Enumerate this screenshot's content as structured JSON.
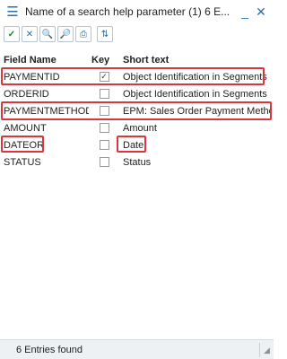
{
  "window": {
    "title": "Name of a search help parameter (1)   6 E...",
    "menu_icon": "hamburger-icon",
    "minimize_glyph": "_",
    "close_glyph": "✕"
  },
  "toolbar": {
    "buttons": [
      {
        "name": "ok-button",
        "icon": "checkmark-icon",
        "glyph": "✓"
      },
      {
        "name": "cancel-button",
        "icon": "close-box-icon",
        "glyph": "✕"
      },
      {
        "name": "find-button",
        "icon": "magnifier-icon",
        "glyph": "🔍"
      },
      {
        "name": "find-next-button",
        "icon": "magnifier-plus-icon",
        "glyph": "🔎"
      },
      {
        "name": "print-button",
        "icon": "printer-icon",
        "glyph": "⎙"
      },
      {
        "name": "sort-button",
        "icon": "sort-icon",
        "glyph": "⇅"
      }
    ]
  },
  "table": {
    "headers": [
      "Field Name",
      "Key",
      "Short text"
    ],
    "rows": [
      {
        "field": "PAYMENTID",
        "key": true,
        "text": "Object Identification in Segments",
        "highlight": true
      },
      {
        "field": "ORDERID",
        "key": false,
        "text": "Object Identification in Segments",
        "highlight": false
      },
      {
        "field": "PAYMENTMETHOD",
        "key": false,
        "text": "EPM: Sales Order Payment Method",
        "highlight": true
      },
      {
        "field": "AMOUNT",
        "key": false,
        "text": "Amount",
        "highlight": false
      },
      {
        "field": "DATEOR",
        "key": false,
        "text": "Date",
        "highlight": true
      },
      {
        "field": "STATUS",
        "key": false,
        "text": "Status",
        "highlight": false
      }
    ]
  },
  "status": {
    "text": "6 Entries found"
  },
  "colors": {
    "accent": "#2c6db0",
    "highlight": "#d9363e"
  }
}
